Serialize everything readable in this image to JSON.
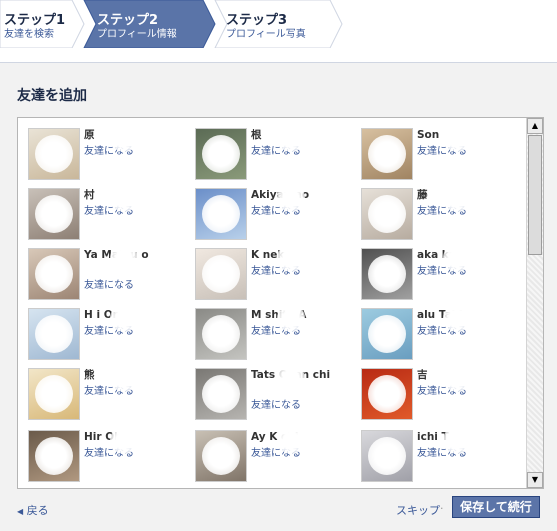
{
  "steps": [
    {
      "title": "ステップ1",
      "subtitle": "友達を検索",
      "state": "done"
    },
    {
      "title": "ステップ2",
      "subtitle": "プロフィール情報",
      "state": "active"
    },
    {
      "title": "ステップ3",
      "subtitle": "プロフィール写真",
      "state": "upcoming"
    }
  ],
  "section_title": "友達を追加",
  "friends": [
    {
      "name": "原",
      "add_label": "友達になる"
    },
    {
      "name": "根",
      "add_label": "友達になる"
    },
    {
      "name": "Son",
      "add_label": "友達になる"
    },
    {
      "name": "村",
      "add_label": "友達になる"
    },
    {
      "name": "Akiyan ao",
      "add_label": "友達になる"
    },
    {
      "name": "藤",
      "add_label": "友達になる"
    },
    {
      "name": "Ya Matsu o",
      "add_label": "友達になる"
    },
    {
      "name": "K neko",
      "add_label": "友達になる"
    },
    {
      "name": "aka ka",
      "add_label": "友達になる"
    },
    {
      "name": "H i Ono",
      "add_label": "友達になる"
    },
    {
      "name": "M shita A",
      "add_label": "友達になる"
    },
    {
      "name": "alu Taki",
      "add_label": "友達になる"
    },
    {
      "name": "熊",
      "add_label": "友達になる"
    },
    {
      "name": "Tats Oyan chi",
      "add_label": "友達になる"
    },
    {
      "name": "吉",
      "add_label": "友達になる"
    },
    {
      "name": "Hir Ohy",
      "add_label": "友達になる"
    },
    {
      "name": "Ay K chi",
      "add_label": "友達になる"
    },
    {
      "name": "ichi T a",
      "add_label": "友達になる"
    }
  ],
  "footer": {
    "back_label": "戻る",
    "skip_label": "スキップ",
    "separator": "·",
    "save_label": "保存して続行"
  },
  "colors": {
    "brand": "#3b5998",
    "active_step": "#3b5998",
    "button": "#5b74a8"
  }
}
